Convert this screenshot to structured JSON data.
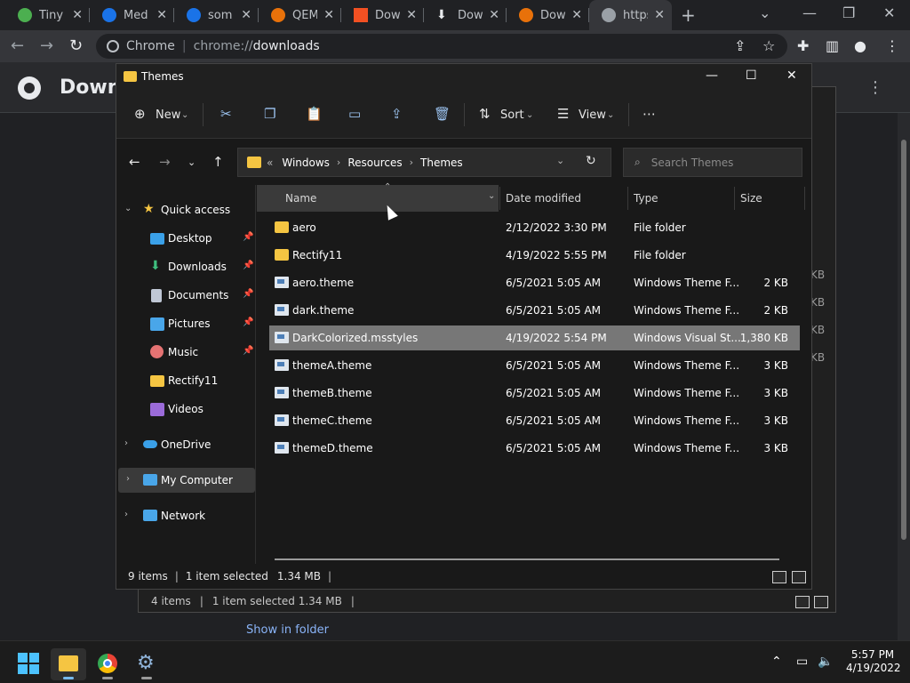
{
  "browser": {
    "tabs": [
      {
        "title": "TinyU",
        "color": "#4caf50"
      },
      {
        "title": "Medi",
        "color": "#1a73e8"
      },
      {
        "title": "some",
        "color": "#1a73e8"
      },
      {
        "title": "QEMI",
        "color": "#e8710a"
      },
      {
        "title": "Dowr",
        "color": "#f25022"
      },
      {
        "title": "Dowr",
        "color": "#bdc1c6"
      },
      {
        "title": "Dowr",
        "color": "#e8710a"
      },
      {
        "title": "https",
        "color": "#9aa0a6"
      }
    ],
    "omnibox": {
      "site_label": "Chrome",
      "scheme": "chrome://",
      "host": "downloads"
    },
    "page_title": "Downl"
  },
  "background_dialog": {
    "items_count": "4 items",
    "selected": "1 item selected  1.34 MB",
    "show_in_folder": "Show in folder",
    "kb_labels": [
      "KB",
      "KB",
      "KB",
      "KB"
    ]
  },
  "explorer": {
    "title": "Themes",
    "command_bar": {
      "new_label": "New",
      "sort_label": "Sort",
      "view_label": "View"
    },
    "breadcrumb": {
      "overflow": "«",
      "items": [
        "Windows",
        "Resources",
        "Themes"
      ]
    },
    "search_placeholder": "Search Themes",
    "nav": {
      "quick_access": "Quick access",
      "items": [
        {
          "label": "Desktop",
          "pinned": true,
          "icon_color": "#3aa0e8"
        },
        {
          "label": "Downloads",
          "pinned": true,
          "icon_color": "#3fbf7f"
        },
        {
          "label": "Documents",
          "pinned": true,
          "icon_color": "#bfc7d5"
        },
        {
          "label": "Pictures",
          "pinned": true,
          "icon_color": "#49a6e9"
        },
        {
          "label": "Music",
          "pinned": true,
          "icon_color": "#e57373"
        },
        {
          "label": "Rectify11",
          "pinned": false,
          "icon_color": "#f5c542"
        },
        {
          "label": "Videos",
          "pinned": false,
          "icon_color": "#9b6bd9"
        }
      ],
      "onedrive": "OneDrive",
      "my_computer": "My Computer",
      "network": "Network"
    },
    "columns": [
      "Name",
      "Date modified",
      "Type",
      "Size"
    ],
    "files": [
      {
        "name": "aero",
        "date": "2/12/2022 3:30 PM",
        "type": "File folder",
        "size": "",
        "kind": "folder"
      },
      {
        "name": "Rectify11",
        "date": "4/19/2022 5:55 PM",
        "type": "File folder",
        "size": "",
        "kind": "folder"
      },
      {
        "name": "aero.theme",
        "date": "6/5/2021 5:05 AM",
        "type": "Windows Theme F...",
        "size": "2 KB",
        "kind": "file"
      },
      {
        "name": "dark.theme",
        "date": "6/5/2021 5:05 AM",
        "type": "Windows Theme F...",
        "size": "2 KB",
        "kind": "file"
      },
      {
        "name": "DarkColorized.msstyles",
        "date": "4/19/2022 5:54 PM",
        "type": "Windows Visual St...",
        "size": "1,380 KB",
        "kind": "file",
        "selected": true
      },
      {
        "name": "themeA.theme",
        "date": "6/5/2021 5:05 AM",
        "type": "Windows Theme F...",
        "size": "3 KB",
        "kind": "file"
      },
      {
        "name": "themeB.theme",
        "date": "6/5/2021 5:05 AM",
        "type": "Windows Theme F...",
        "size": "3 KB",
        "kind": "file"
      },
      {
        "name": "themeC.theme",
        "date": "6/5/2021 5:05 AM",
        "type": "Windows Theme F...",
        "size": "3 KB",
        "kind": "file"
      },
      {
        "name": "themeD.theme",
        "date": "6/5/2021 5:05 AM",
        "type": "Windows Theme F...",
        "size": "3 KB",
        "kind": "file"
      }
    ],
    "status": {
      "items": "9 items",
      "selected": "1 item selected",
      "size": "1.34 MB"
    }
  },
  "taskbar": {
    "time": "5:57 PM",
    "date": "4/19/2022"
  }
}
